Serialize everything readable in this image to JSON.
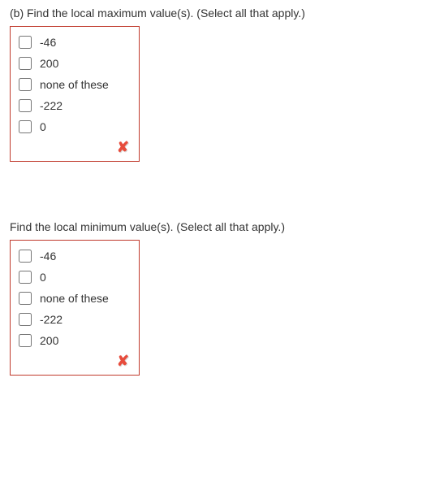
{
  "questions": [
    {
      "prompt": "(b) Find the local maximum value(s). (Select all that apply.)",
      "options": [
        "-46",
        "200",
        "none of these",
        "-222",
        "0"
      ],
      "feedback": "incorrect"
    },
    {
      "prompt": "Find the local minimum value(s). (Select all that apply.)",
      "options": [
        "-46",
        "0",
        "none of these",
        "-222",
        "200"
      ],
      "feedback": "incorrect"
    }
  ]
}
